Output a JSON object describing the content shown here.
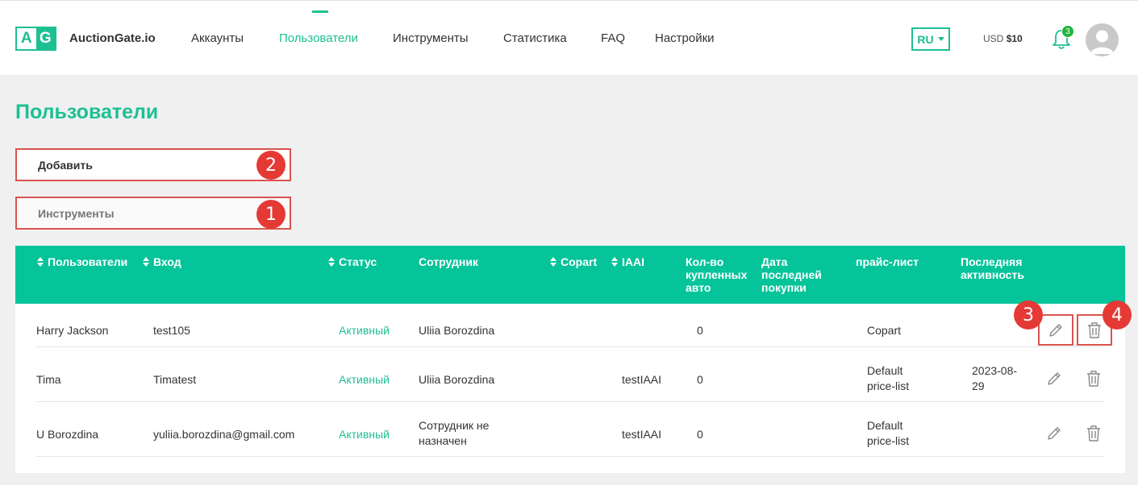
{
  "header": {
    "logo": {
      "left": "A",
      "right": "G"
    },
    "brand": "AuctionGate.io",
    "nav": [
      {
        "label": "Аккаунты"
      },
      {
        "label": "Пользователи",
        "active": true
      },
      {
        "label": "Инструменты"
      },
      {
        "label": "Статистика"
      },
      {
        "label": "FAQ"
      },
      {
        "label": "Настройки"
      }
    ],
    "language": "RU",
    "balance_currency": "USD",
    "balance_amount": "$10",
    "notifications_count": "3",
    "icons": {
      "bell": "bell-icon",
      "avatar": "user-avatar-icon",
      "caret": "caret-down-icon"
    }
  },
  "page": {
    "title": "Пользователи",
    "add_label": "Добавить",
    "tools_label": "Инструменты",
    "markers": [
      "1",
      "2",
      "3",
      "4"
    ]
  },
  "table": {
    "columns": [
      {
        "label": "Пользователи",
        "sortable": true
      },
      {
        "label": "Вход",
        "sortable": true
      },
      {
        "label": "Статус",
        "sortable": true
      },
      {
        "label": "Сотрудник",
        "sortable": false
      },
      {
        "label": "Copart",
        "sortable": true
      },
      {
        "label": "IAAI",
        "sortable": true
      },
      {
        "label": "Кол-во купленных авто",
        "sortable": false
      },
      {
        "label": "Дата последней покупки",
        "sortable": false
      },
      {
        "label": "прайс-лист",
        "sortable": false
      },
      {
        "label": "Последняя активность",
        "sortable": false
      }
    ],
    "rows": [
      {
        "user": "Harry Jackson",
        "login": "test105",
        "status": "Активный",
        "employee": "Uliia Borozdina",
        "copart": "",
        "iaai": "",
        "purchased": "0",
        "last_purchase": "",
        "price_list": "Copart",
        "last_activity": ""
      },
      {
        "user": "Tima",
        "login": "Timatest",
        "status": "Активный",
        "employee": "Uliia Borozdina",
        "copart": "",
        "iaai": "testIAAI",
        "purchased": "0",
        "last_purchase": "",
        "price_list": "Default price-list",
        "last_activity": "2023-08-29"
      },
      {
        "user": "U Borozdina",
        "login": "yuliia.borozdina@gmail.com",
        "status": "Активный",
        "employee": "Сотрудник не назначен",
        "copart": "",
        "iaai": "testIAAI",
        "purchased": "0",
        "last_purchase": "",
        "price_list": "Default price-list",
        "last_activity": ""
      }
    ],
    "row_icons": {
      "edit": "pencil-icon",
      "delete": "trash-icon"
    }
  },
  "colors": {
    "accent": "#1dc092",
    "table_header": "#06c49a",
    "highlight": "#d9534f",
    "marker": "#e53935",
    "badge": "#21b53d"
  }
}
